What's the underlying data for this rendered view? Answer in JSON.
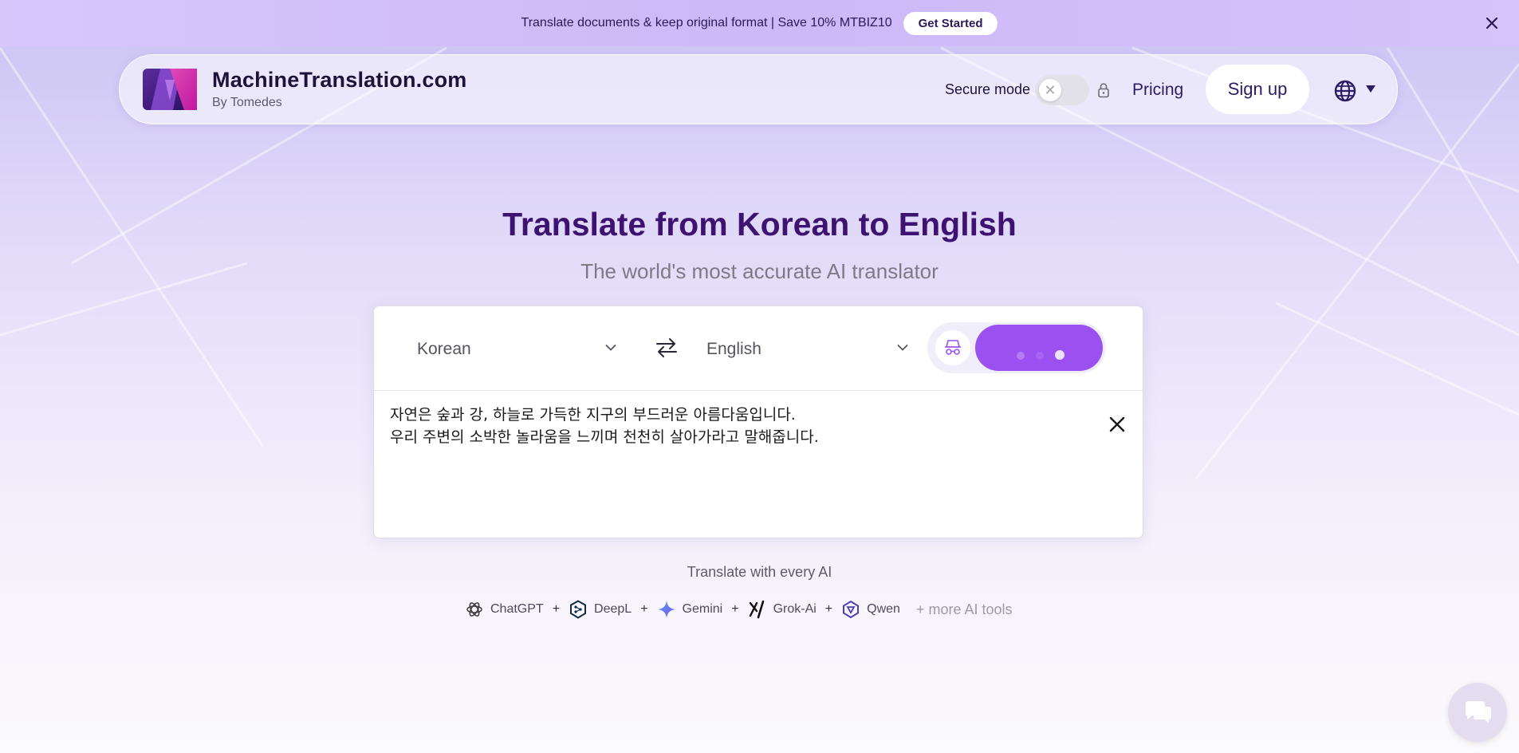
{
  "promo": {
    "text": "Translate documents & keep original format | Save 10% MTBIZ10",
    "button_label": "Get Started"
  },
  "header": {
    "brand_title": "MachineTranslation.com",
    "brand_sub": "By Tomedes",
    "secure_mode_label": "Secure mode",
    "secure_mode_on": false,
    "pricing_label": "Pricing",
    "signup_label": "Sign up"
  },
  "hero": {
    "title": "Translate from Korean to English",
    "subtitle": "The world's most accurate AI translator"
  },
  "translator": {
    "source_language": "Korean",
    "target_language": "English",
    "source_text_lines": [
      "자연은 숲과 강, 하늘로 가득한 지구의 부드러운 아름다움입니다.",
      "우리 주변의 소박한 놀라움을 느끼며 천천히 살아가라고 말해줍니다."
    ]
  },
  "ai_tools": {
    "caption": "Translate with every AI",
    "items": [
      {
        "name": "ChatGPT",
        "icon": "chatgpt-icon"
      },
      {
        "name": "DeepL",
        "icon": "deepl-icon"
      },
      {
        "name": "Gemini",
        "icon": "gemini-icon"
      },
      {
        "name": "Grok-Ai",
        "icon": "grok-icon"
      },
      {
        "name": "Qwen",
        "icon": "qwen-icon"
      }
    ],
    "separator": "+",
    "more_label": "+ more AI tools"
  },
  "colors": {
    "accent": "#9b50f0",
    "title": "#3d1270",
    "promo_bg": "#d3c1fa"
  }
}
